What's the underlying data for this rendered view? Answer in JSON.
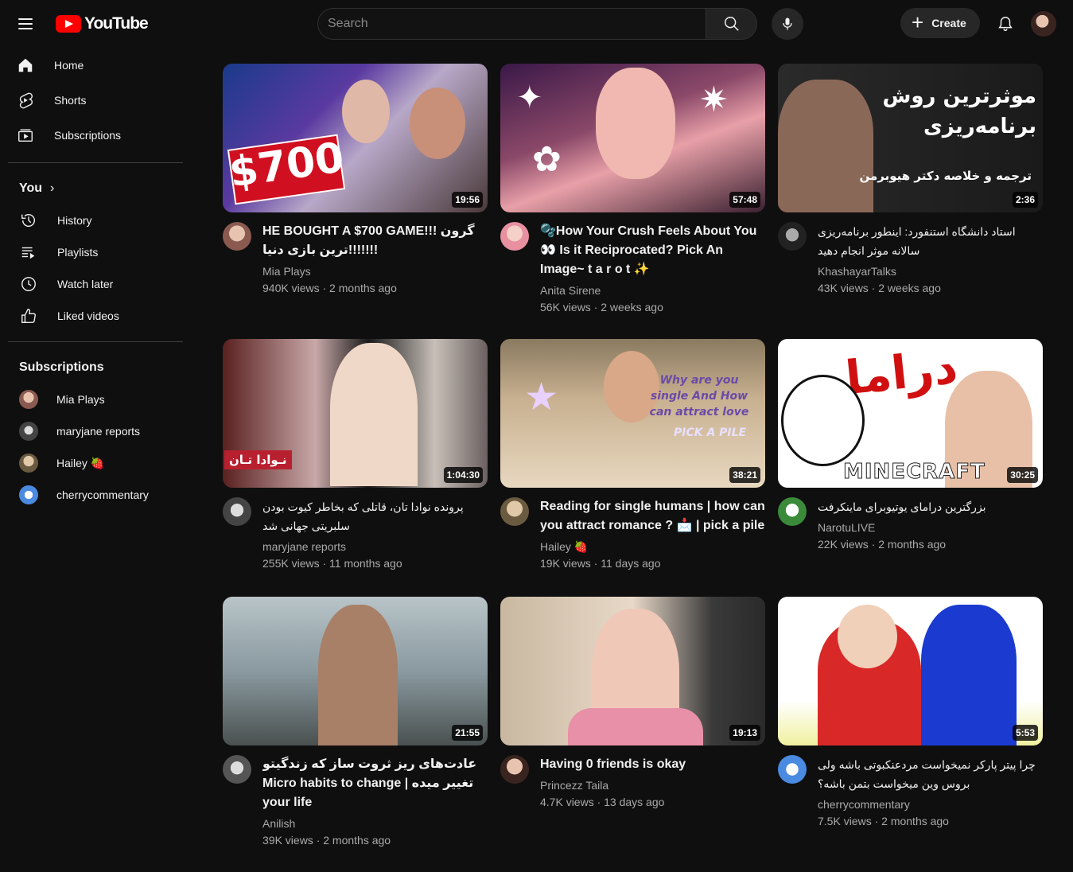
{
  "header": {
    "logo_text": "YouTube",
    "search_placeholder": "Search",
    "create_label": "Create"
  },
  "sidebar": {
    "main": [
      {
        "label": "Home",
        "icon": "home-icon"
      },
      {
        "label": "Shorts",
        "icon": "shorts-icon"
      },
      {
        "label": "Subscriptions",
        "icon": "subscriptions-icon"
      }
    ],
    "you_label": "You",
    "you_items": [
      {
        "label": "History",
        "icon": "history-icon"
      },
      {
        "label": "Playlists",
        "icon": "playlists-icon"
      },
      {
        "label": "Watch later",
        "icon": "clock-icon"
      },
      {
        "label": "Liked videos",
        "icon": "thumbs-up-icon"
      }
    ],
    "subscriptions_label": "Subscriptions",
    "subscriptions": [
      {
        "name": "Mia Plays",
        "color": "#c9998a"
      },
      {
        "name": "maryjane reports",
        "color": "#777777"
      },
      {
        "name": "Hailey 🍓",
        "color": "#b8a07a"
      },
      {
        "name": "cherrycommentary",
        "color": "#5a9ae0"
      }
    ]
  },
  "videos": [
    {
      "title": "HE BOUGHT A $700 GAME!!! گرون ترین بازی دنیا!!!!!!!",
      "channel": "Mia Plays",
      "stats": "940K views · 2 months ago",
      "duration": "19:56",
      "thumb_text": "$700",
      "avatar_color": "#c9998a"
    },
    {
      "title": "🫧How Your Crush Feels About You 👀 Is it Reciprocated? Pick An Image~ t a r o t ✨",
      "channel": "Anita Sirene",
      "stats": "56K views · 2 weeks ago",
      "duration": "57:48",
      "thumb_text": "",
      "avatar_color": "#e8a0b0"
    },
    {
      "title": "استاد دانشگاه استنفورد: اینطور برنامه‌ریزی سالانه موثر انجام دهید",
      "channel": "KhashayarTalks",
      "stats": "43K views · 2 weeks ago",
      "duration": "2:36",
      "thumb_text": "موثرترین روش برنامه‌ریزی",
      "thumb_sub": "ترجمه و خلاصه دکتر هیوبرمن",
      "avatar_color": "#333333"
    },
    {
      "title": "پرونده نوادا تان، قاتلی که بخاطر کیوت بودن سلبریتی جهانی شد",
      "channel": "maryjane reports",
      "stats": "255K views · 11 months ago",
      "duration": "1:04:30",
      "thumb_text": "نـوادا تـان",
      "avatar_color": "#777777"
    },
    {
      "title": "Reading for single humans | how can you attract romance ? 📩 | pick a pile",
      "channel": "Hailey 🍓",
      "stats": "19K views · 11 days ago",
      "duration": "38:21",
      "thumb_text": "Why are you single And How can attract love",
      "thumb_sub": "PICK A PILE",
      "avatar_color": "#b8a07a"
    },
    {
      "title": "بزرگترین درامای یوتیوبرای ماینکرفت",
      "channel": "NarotuLIVE",
      "stats": "22K views · 2 months ago",
      "duration": "30:25",
      "thumb_text": "دراما",
      "thumb_sub": "MINECRAFT",
      "avatar_color": "#4caf50"
    },
    {
      "title": "عادت‌های ریز ثروت ساز که زندگیتو تغییر میده | Micro habits to change your life",
      "channel": "Anilish",
      "stats": "39K views · 2 months ago",
      "duration": "21:55",
      "thumb_text": "",
      "avatar_color": "#888888"
    },
    {
      "title": "Having 0 friends is okay",
      "channel": "Princezz Taila",
      "stats": "4.7K views · 13 days ago",
      "duration": "19:13",
      "thumb_text": "",
      "avatar_color": "#5a4038"
    },
    {
      "title": "چرا پیتر پارکر نمیخواست مردعنکبوتی باشه ولی بروس وین میخواست بتمن باشه؟",
      "channel": "cherrycommentary",
      "stats": "7.5K views · 2 months ago",
      "duration": "5:53",
      "thumb_text": "",
      "avatar_color": "#5a9ae0"
    }
  ],
  "colors": {
    "background": "#0f0f0f",
    "brand_red": "#ff0000",
    "secondary_text": "#aaaaaa"
  }
}
